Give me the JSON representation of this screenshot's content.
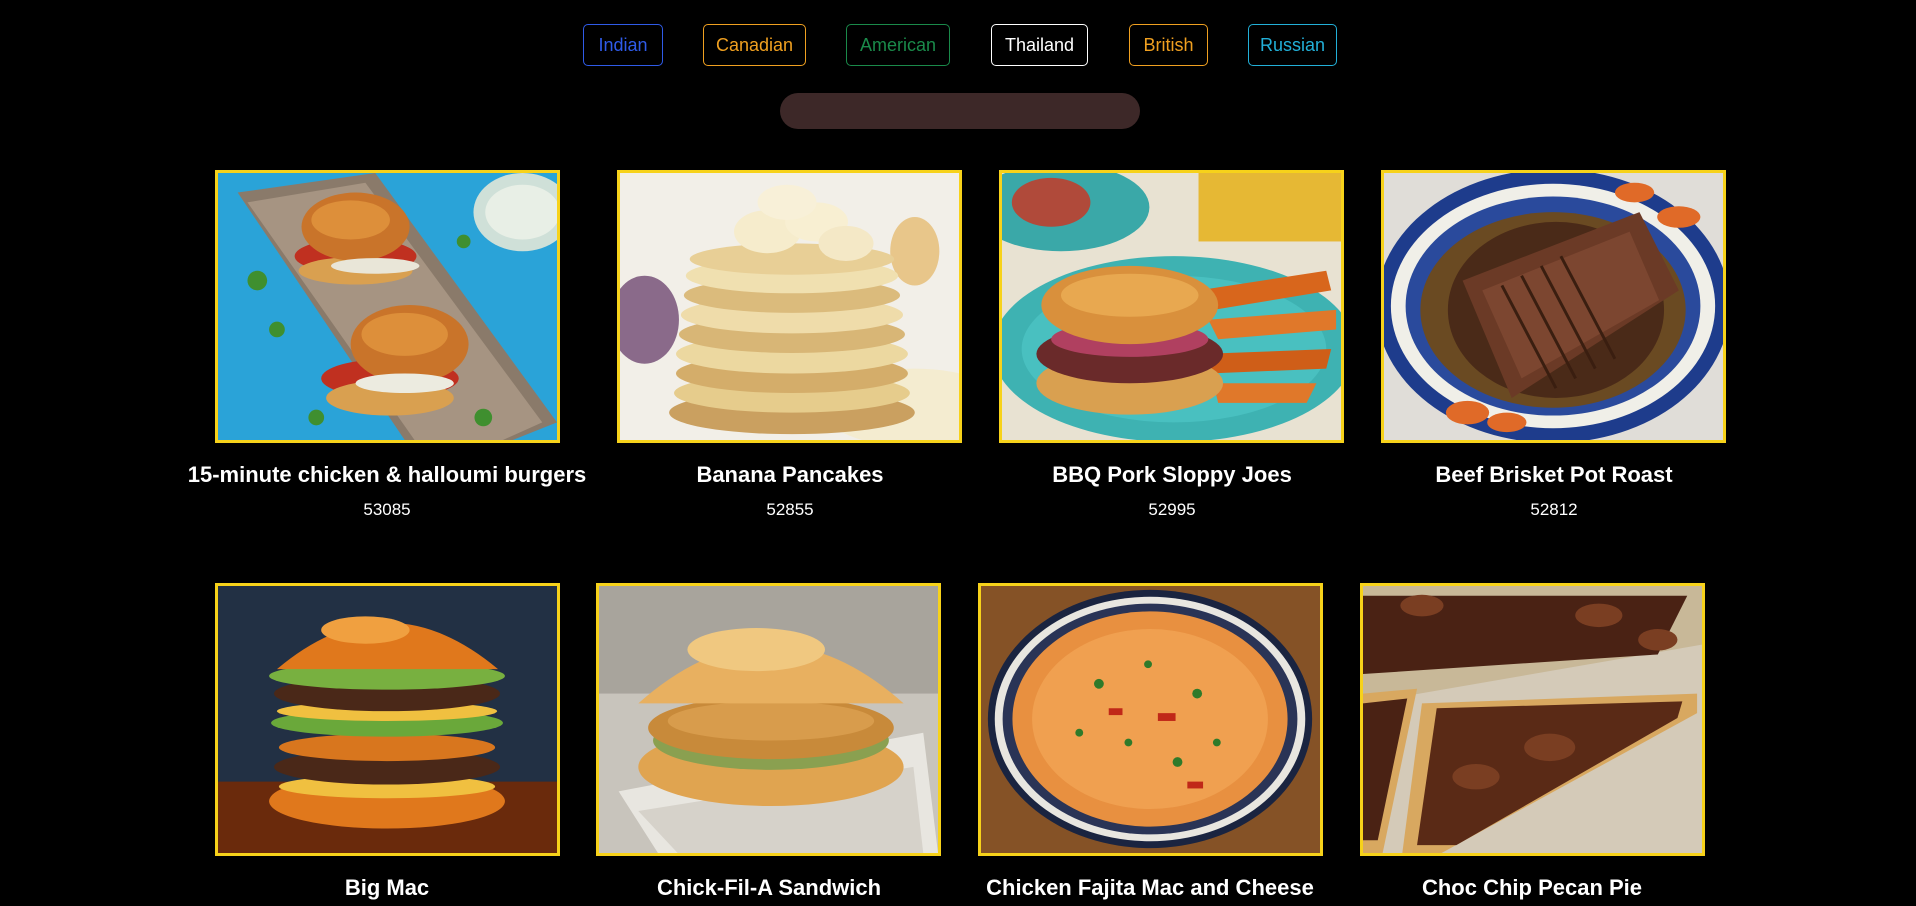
{
  "filters": [
    {
      "label": "Indian",
      "color": "#2f5be8"
    },
    {
      "label": "Canadian",
      "color": "#f0a020"
    },
    {
      "label": "American",
      "color": "#1a8a4a"
    },
    {
      "label": "Thailand",
      "color": "#ffffff"
    },
    {
      "label": "British",
      "color": "#f0a020"
    },
    {
      "label": "Russian",
      "color": "#22b0d8"
    }
  ],
  "search": {
    "placeholder": "",
    "value": ""
  },
  "meals": [
    {
      "title": "15-minute chicken & halloumi burgers",
      "id": "53085",
      "image": "burgers-on-board"
    },
    {
      "title": "Banana Pancakes",
      "id": "52855",
      "image": "pancake-stack"
    },
    {
      "title": "BBQ Pork Sloppy Joes",
      "id": "52995",
      "image": "sloppy-joe-plate"
    },
    {
      "title": "Beef Brisket Pot Roast",
      "id": "52812",
      "image": "brisket-platter"
    },
    {
      "title": "Big Mac",
      "id": "",
      "image": "double-burger"
    },
    {
      "title": "Chick-Fil-A Sandwich",
      "id": "",
      "image": "chicken-sandwich"
    },
    {
      "title": "Chicken Fajita Mac and Cheese",
      "id": "",
      "image": "pasta-bowl"
    },
    {
      "title": "Choc Chip Pecan Pie",
      "id": "",
      "image": "pecan-pie"
    }
  ],
  "colors": {
    "card_border": "#f7d21a",
    "background": "#000000",
    "search_bg": "#3d2828"
  }
}
